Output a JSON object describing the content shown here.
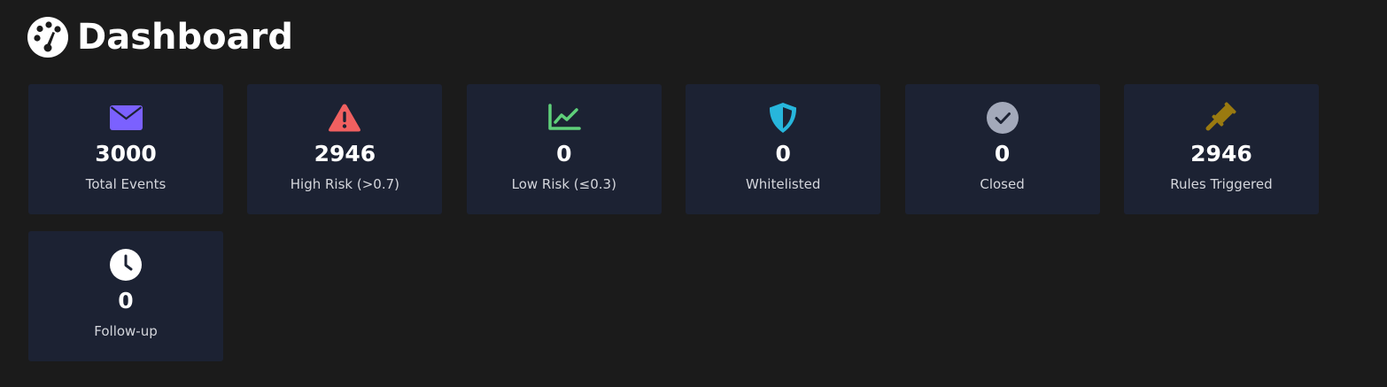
{
  "header": {
    "title": "Dashboard",
    "icon": "tachometer-icon"
  },
  "cards": [
    {
      "value": "3000",
      "label": "Total Events",
      "icon": "envelope-icon",
      "color": "#7b61ff"
    },
    {
      "value": "2946",
      "label": "High Risk (>0.7)",
      "icon": "warning-triangle-icon",
      "color": "#f06060"
    },
    {
      "value": "0",
      "label": "Low Risk (≤0.3)",
      "icon": "line-chart-icon",
      "color": "#5fd07a"
    },
    {
      "value": "0",
      "label": "Whitelisted",
      "icon": "shield-icon",
      "color": "#27b6dc"
    },
    {
      "value": "0",
      "label": "Closed",
      "icon": "check-circle-icon",
      "color": "#a3a9ba"
    },
    {
      "value": "2946",
      "label": "Rules Triggered",
      "icon": "gavel-icon",
      "color": "#9a7a10"
    },
    {
      "value": "0",
      "label": "Follow-up",
      "icon": "clock-icon",
      "color": "#ffffff"
    }
  ]
}
